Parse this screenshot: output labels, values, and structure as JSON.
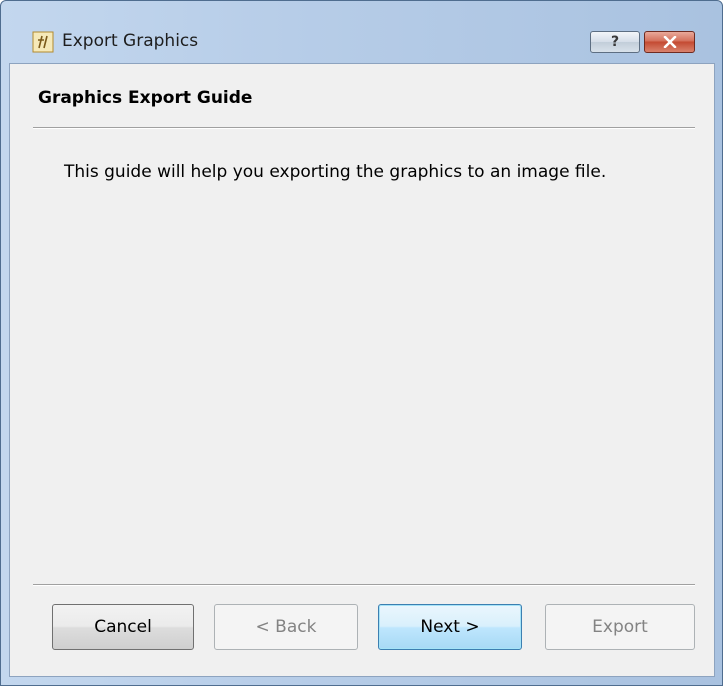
{
  "window": {
    "title": "Export Graphics",
    "help_label": "?",
    "close_label": "✕"
  },
  "guide": {
    "title": "Graphics Export Guide",
    "description": "This guide will help you exporting the graphics to an image file."
  },
  "buttons": {
    "cancel": "Cancel",
    "back": "< Back",
    "next": "Next >",
    "export": "Export"
  },
  "icons": {
    "app": "function-f-icon",
    "help": "question-mark-icon",
    "close": "close-x-icon"
  },
  "colors": {
    "close_button": "#c44a32",
    "default_button_border": "#3c7fb1",
    "disabled_text": "#838383"
  }
}
